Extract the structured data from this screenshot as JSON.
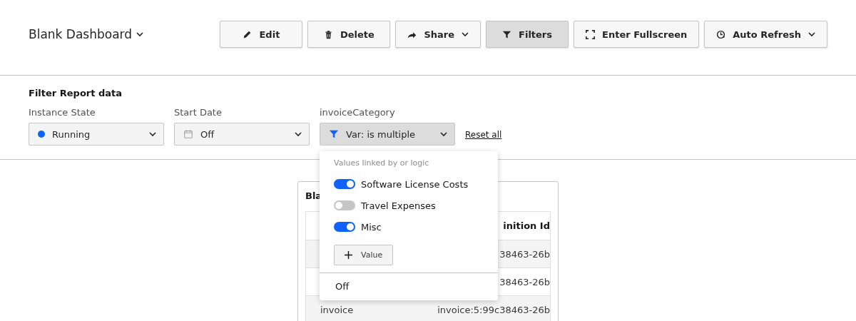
{
  "dashboard": {
    "title": "Blank Dashboard"
  },
  "toolbar": [
    {
      "label": "Edit",
      "kind": "edit",
      "selected": false,
      "has_caret": false
    },
    {
      "label": "Delete",
      "kind": "delete",
      "selected": false,
      "has_caret": false
    },
    {
      "label": "Share",
      "kind": "share",
      "selected": false,
      "has_caret": true
    },
    {
      "label": "Filters",
      "kind": "filter",
      "selected": true,
      "has_caret": false
    },
    {
      "label": "Enter Fullscreen",
      "kind": "fullscreen",
      "selected": false,
      "has_caret": false
    },
    {
      "label": "Auto Refresh",
      "kind": "refresh",
      "selected": false,
      "has_caret": true
    }
  ],
  "filter_panel": {
    "title": "Filter Report data",
    "filters": [
      {
        "label": "Instance State",
        "value": "Running",
        "kind": "state",
        "expanded": false
      },
      {
        "label": "Start Date",
        "value": "Off",
        "kind": "date",
        "expanded": false
      },
      {
        "label": "invoiceCategory",
        "value": "Var: is multiple",
        "kind": "variable",
        "expanded": true
      }
    ],
    "reset_link": "Reset all"
  },
  "dropdown": {
    "hint": "Values linked by or logic",
    "values": [
      {
        "label": "Software License Costs",
        "on": true
      },
      {
        "label": "Travel Expenses",
        "on": false
      },
      {
        "label": "Misc",
        "on": true
      }
    ],
    "add_button": "Value",
    "off_option": "Off"
  },
  "report": {
    "title": "Bla",
    "header": {
      "column_2": "inition Id"
    },
    "rows": [
      {
        "column_2": "38463-26b"
      },
      {
        "column_2": "38463-26b"
      },
      {
        "column_1": "invoice",
        "column_2": "invoice:5:99c38463-26b"
      }
    ]
  }
}
